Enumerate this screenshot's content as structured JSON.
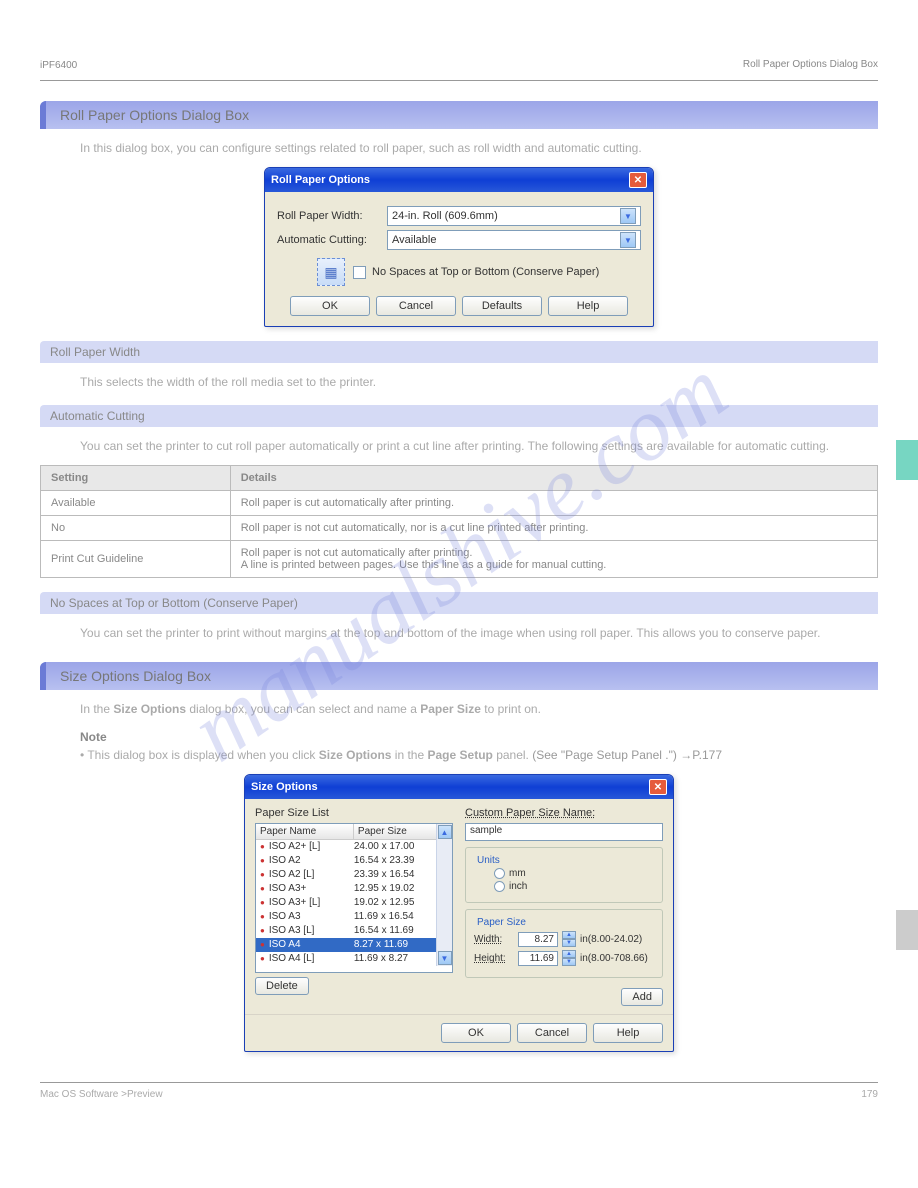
{
  "header": {
    "left": "iPF6400",
    "right": "Roll Paper Options Dialog Box"
  },
  "watermark": "manualshive.com",
  "section1": {
    "title": "Roll Paper Options Dialog Box",
    "intro": "In this dialog box, you can configure settings related to roll paper, such as roll width and automatic cutting."
  },
  "dlg1": {
    "title": "Roll Paper Options",
    "width_label": "Roll Paper Width:",
    "width_value": "24-in. Roll (609.6mm)",
    "cut_label": "Automatic Cutting:",
    "cut_value": "Available",
    "conserve_label": "No Spaces at Top or Bottom (Conserve Paper)",
    "buttons": {
      "ok": "OK",
      "cancel": "Cancel",
      "defaults": "Defaults",
      "help": "Help"
    }
  },
  "sub1": {
    "title": "Roll Paper Width",
    "text": "This selects the width of the roll media set to the printer."
  },
  "sub2": {
    "title": "Automatic Cutting",
    "text": "You can set the printer to cut roll paper automatically or print a cut line after printing. The following settings are available for automatic cutting."
  },
  "table": {
    "head": [
      "Setting",
      "Details"
    ],
    "rows": [
      [
        "Available",
        "Roll paper is cut automatically after printing."
      ],
      [
        "No",
        "Roll paper is not cut automatically, nor is a cut line printed after printing."
      ],
      [
        "Print Cut Guideline",
        "Roll paper is not cut automatically after printing.\nA line is printed between pages. Use this line as a guide for manual cutting."
      ]
    ]
  },
  "sub3": {
    "title": "No Spaces at Top or Bottom (Conserve Paper)",
    "text": "You can set the printer to print without margins at the top and bottom of the image when using roll paper. This allows you to conserve paper."
  },
  "section2": {
    "title": "Size Options Dialog Box",
    "intro": "In the ",
    "intro_bold": "Size Options",
    "intro2": " dialog box, you can can select and name a ",
    "intro_bold2": "Paper Size",
    "intro3": " to print on.",
    "note_label": "Note",
    "note1": "• This dialog box is displayed when you click ",
    "note1_bold": "Size Options",
    "note1b": " in the ",
    "note1_bold2": "Page Setup",
    "note1c": " panel. ",
    "note1_link": "(See \"Page Setup Panel .\")",
    "note1_page": "→P.177"
  },
  "dlg2": {
    "title": "Size Options",
    "paper_size_list": "Paper Size List",
    "columns": [
      "Paper Name",
      "Paper Size"
    ],
    "items": [
      {
        "name": "ISO A2+ [L]",
        "size": "24.00 x 17.00"
      },
      {
        "name": "ISO A2",
        "size": "16.54 x 23.39"
      },
      {
        "name": "ISO A2 [L]",
        "size": "23.39 x 16.54"
      },
      {
        "name": "ISO A3+",
        "size": "12.95 x 19.02"
      },
      {
        "name": "ISO A3+ [L]",
        "size": "19.02 x 12.95"
      },
      {
        "name": "ISO A3",
        "size": "11.69 x 16.54"
      },
      {
        "name": "ISO A3 [L]",
        "size": "16.54 x 11.69"
      },
      {
        "name": "ISO A4",
        "size": "8.27 x 11.69",
        "selected": true
      },
      {
        "name": "ISO A4 [L]",
        "size": "11.69 x 8.27"
      }
    ],
    "delete": "Delete",
    "custom_name_label": "Custom Paper Size Name:",
    "custom_name_value": "sample",
    "units": {
      "label": "Units",
      "mm": "mm",
      "inch": "inch"
    },
    "papersize": {
      "label": "Paper Size",
      "width_label": "Width:",
      "width_value": "8.27",
      "width_range": "in(8.00-24.02)",
      "height_label": "Height:",
      "height_value": "11.69",
      "height_range": "in(8.00-708.66)"
    },
    "add": "Add",
    "buttons": {
      "ok": "OK",
      "cancel": "Cancel",
      "help": "Help"
    }
  },
  "footer": {
    "left": "Mac OS Software >Preview",
    "right": "179"
  }
}
